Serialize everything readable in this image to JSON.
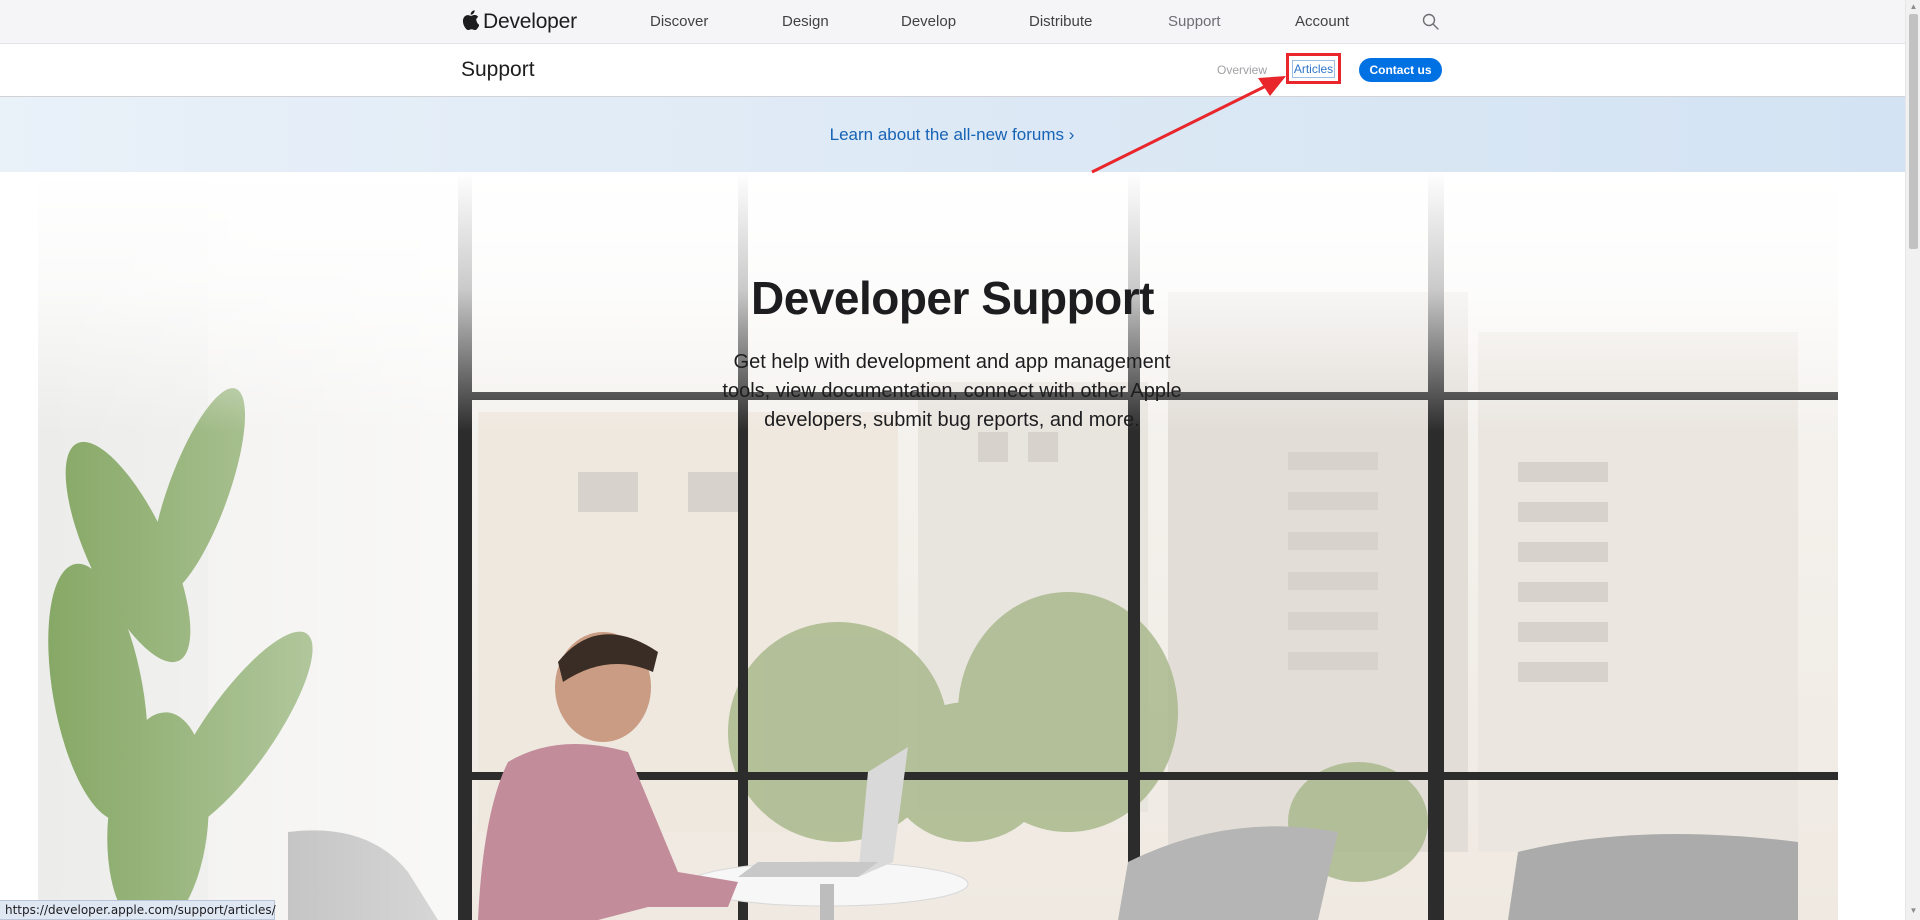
{
  "global_nav": {
    "brand": "Developer",
    "items": [
      {
        "label": "Discover"
      },
      {
        "label": "Design"
      },
      {
        "label": "Develop"
      },
      {
        "label": "Distribute"
      },
      {
        "label": "Support"
      },
      {
        "label": "Account"
      }
    ],
    "search_icon": "search-icon"
  },
  "local_nav": {
    "title": "Support",
    "overview": "Overview",
    "articles": "Articles",
    "contact": "Contact us"
  },
  "banner": {
    "text": "Learn about the all-new forums ›"
  },
  "hero": {
    "title": "Developer Support",
    "subtitle": "Get help with development and app management tools, view documentation, connect with other Apple developers, submit bug reports, and more."
  },
  "status_bar": {
    "url": "https://developer.apple.com/support/articles/"
  },
  "colors": {
    "accent": "#0071e3",
    "link": "#1763b5",
    "annotation": "#e8262b"
  }
}
